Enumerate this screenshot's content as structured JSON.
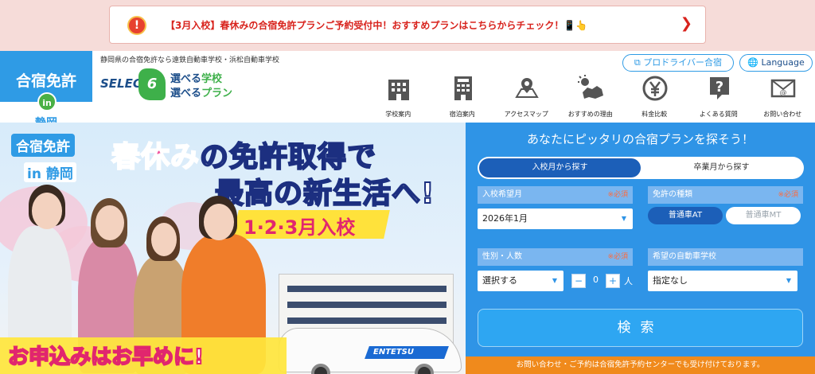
{
  "notice": {
    "text": "【3月入校】春休みの合宿免許プランご予約受付中！おすすめプランはこちらからチェック！📱👆",
    "icon": "alert-icon",
    "chevron": "❯"
  },
  "header": {
    "logo_top": "合宿免許",
    "logo_in": "in",
    "logo_bottom": "静岡",
    "tagline": "静岡県の合宿免許なら遠鉄自動車学校・浜松自動車学校",
    "select_word": "SELECT",
    "select_num": "6",
    "select_line1_a": "選べる",
    "select_line1_b": "学校",
    "select_line2_a": "選べる",
    "select_line2_b": "プラン",
    "pro_driver": "プロドライバー合宿",
    "language": "Language",
    "nav": [
      {
        "label": "学校案内",
        "icon": "school-building-icon"
      },
      {
        "label": "宿泊案内",
        "icon": "hotel-icon"
      },
      {
        "label": "アクセスマップ",
        "icon": "map-pin-icon"
      },
      {
        "label": "おすすめの理由",
        "icon": "shizuoka-map-icon"
      },
      {
        "label": "料金比較",
        "icon": "yen-icon"
      },
      {
        "label": "よくある質問",
        "icon": "question-icon"
      },
      {
        "label": "お問い合わせ",
        "icon": "mail-icon"
      }
    ]
  },
  "hero": {
    "logo1": "合宿免許",
    "logo2": "in",
    "logo3": "静岡",
    "headline_pink": "春休み",
    "headline1_rest": "の免許取得で",
    "headline2": "最高の新生活へ!",
    "months": "1·2·3月入校",
    "cta": "お申込みはお早めに!",
    "car_brand": "ENTETSU"
  },
  "search": {
    "title": "あなたにピッタリの合宿プランを探そう！",
    "tab_active": "入校月から探す",
    "tab_inactive": "卒業月から探す",
    "required": "※必須",
    "entry_month_label": "入校希望月",
    "entry_month_value": "2026年1月",
    "license_label": "免許の種類",
    "license_at": "普通車AT",
    "license_mt": "普通車MT",
    "gender_label": "性別・人数",
    "gender_value": "選択する",
    "count_value": "0",
    "count_unit": "人",
    "school_label": "希望の自動車学校",
    "school_value": "指定なし",
    "search_button": "検索",
    "minus": "−",
    "plus": "+",
    "caret": "▼"
  },
  "footer": {
    "text": "お問い合わせ・ご予約は合宿免許予約センターでも受け付けております。"
  }
}
